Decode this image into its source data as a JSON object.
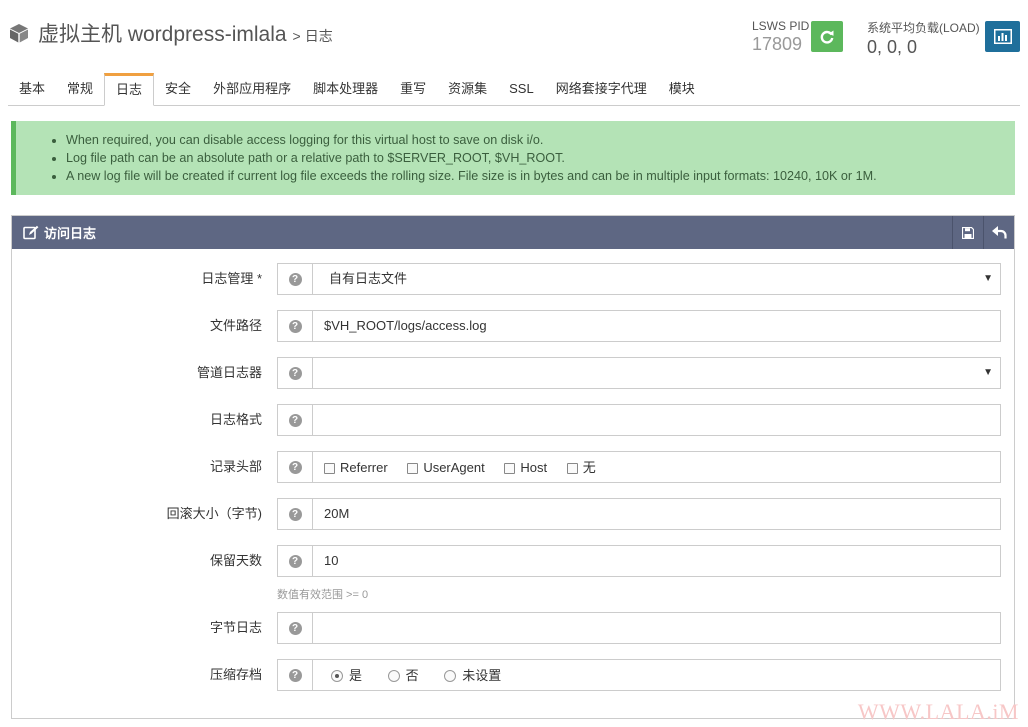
{
  "header": {
    "title": "虚拟主机 wordpress-imlala",
    "separator": ">",
    "subtitle": "日志",
    "pid_label": "LSWS PID",
    "pid_value": "17809",
    "load_label": "系统平均负载(LOAD)",
    "load_value": "0, 0, 0"
  },
  "tabs": [
    "基本",
    "常规",
    "日志",
    "安全",
    "外部应用程序",
    "脚本处理器",
    "重写",
    "资源集",
    "SSL",
    "网络套接字代理",
    "模块"
  ],
  "active_tab": "日志",
  "alert": {
    "items": [
      "When required, you can disable access logging for this virtual host to save on disk i/o.",
      "Log file path can be an absolute path or a relative path to $SERVER_ROOT, $VH_ROOT.",
      "A new log file will be created if current log file exceeds the rolling size. File size is in bytes and can be in multiple input formats: 10240, 10K or 1M."
    ]
  },
  "panel": {
    "title": "访问日志",
    "fields": {
      "log_management": {
        "label": "日志管理 *",
        "value": "自有日志文件"
      },
      "file_path": {
        "label": "文件路径",
        "value": "$VH_ROOT/logs/access.log"
      },
      "piped_logger": {
        "label": "管道日志器",
        "value": ""
      },
      "log_format": {
        "label": "日志格式",
        "value": ""
      },
      "log_headers": {
        "label": "记录头部",
        "options": [
          "Referrer",
          "UserAgent",
          "Host",
          "无"
        ]
      },
      "rolling_size": {
        "label": "回滚大小（字节)",
        "value": "20M"
      },
      "keep_days": {
        "label": "保留天数",
        "value": "10",
        "hint": "数值有效范围 >= 0"
      },
      "bytes_log": {
        "label": "字节日志",
        "value": ""
      },
      "compress_archive": {
        "label": "压缩存档",
        "options": [
          "是",
          "否",
          "未设置"
        ],
        "selected": "是"
      }
    }
  },
  "watermark": "WWW.LALA.iM",
  "colors": {
    "restart_button": "#5cb85c",
    "stats_button": "#1f6f9b",
    "panel_header": "#5e6783",
    "alert_bg": "#b4e3b6",
    "active_tab_accent": "#f0a040"
  },
  "icons": {
    "title": "cube-icon",
    "restart": "refresh-icon",
    "stats": "bar-chart-icon",
    "panel": "edit-icon",
    "save": "save-icon",
    "back": "undo-icon",
    "help": "question-circle-icon"
  }
}
